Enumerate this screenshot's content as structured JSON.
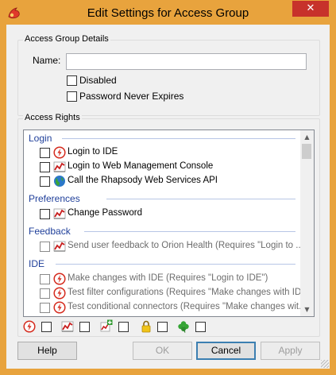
{
  "window": {
    "title": "Edit Settings for Access Group",
    "close_glyph": "✕"
  },
  "details": {
    "legend": "Access Group Details",
    "name_label": "Name:",
    "name_value": "",
    "disabled_label": "Disabled",
    "password_label": "Password Never Expires"
  },
  "rights": {
    "legend": "Access Rights",
    "categories": [
      {
        "name": "Login",
        "items": [
          {
            "icon": "lightning-icon",
            "label": "Login to IDE",
            "enabled": true
          },
          {
            "icon": "chart-icon",
            "label": "Login to Web Management Console",
            "enabled": true
          },
          {
            "icon": "globe-icon",
            "label": "Call the Rhapsody Web Services API",
            "enabled": true
          }
        ]
      },
      {
        "name": "Preferences",
        "items": [
          {
            "icon": "chart-icon",
            "label": "Change Password",
            "enabled": true
          }
        ]
      },
      {
        "name": "Feedback",
        "items": [
          {
            "icon": "chart-icon",
            "label": "Send user feedback to Orion Health (Requires \"Login to ...",
            "enabled": false
          }
        ]
      },
      {
        "name": "IDE",
        "items": [
          {
            "icon": "lightning-icon",
            "label": "Make changes with IDE (Requires \"Login to IDE\")",
            "enabled": false
          },
          {
            "icon": "lightning-icon",
            "label": "Test filter configurations (Requires \"Make changes with ID...",
            "enabled": false
          },
          {
            "icon": "lightning-icon",
            "label": "Test conditional connectors (Requires \"Make changes wit...",
            "enabled": false
          }
        ]
      }
    ],
    "legend_icons": [
      "lightning-icon",
      "chart-icon",
      "chart-plus-icon",
      "lock-icon",
      "clover-icon"
    ]
  },
  "buttons": {
    "help": "Help",
    "ok": "OK",
    "cancel": "Cancel",
    "apply": "Apply"
  },
  "colors": {
    "titlebar": "#e8a33d",
    "close": "#c7322b",
    "category": "#1f3f9a"
  }
}
